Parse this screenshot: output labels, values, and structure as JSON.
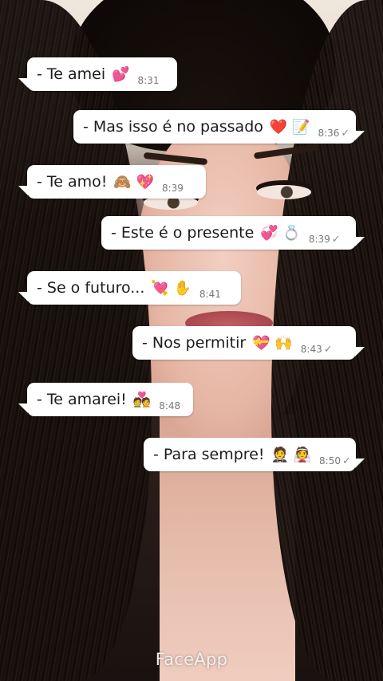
{
  "watermark": "FaceApp",
  "messages": [
    {
      "text": "- Te amei",
      "emoji": "💕",
      "time": "8:31"
    },
    {
      "text": "- Mas isso é no passado",
      "emoji": "❤️ 📝",
      "time": "8:36",
      "tick": "✓"
    },
    {
      "text": "- Te amo!",
      "emoji": "🙈 💖",
      "time": "8:39"
    },
    {
      "text": "- Este é o presente",
      "emoji": "💞 💍",
      "time": "8:39",
      "tick": "✓"
    },
    {
      "text": "- Se o futuro...",
      "emoji": "💘 ✋",
      "time": "8:41"
    },
    {
      "text": "- Nos permitir",
      "emoji": "💝 🙌",
      "time": "8:43",
      "tick": "✓"
    },
    {
      "text": "- Te amarei!",
      "emoji": "💑",
      "time": "8:48"
    },
    {
      "text": "- Para sempre!",
      "emoji": "🤵 👰",
      "time": "8:50",
      "tick": "✓"
    }
  ]
}
